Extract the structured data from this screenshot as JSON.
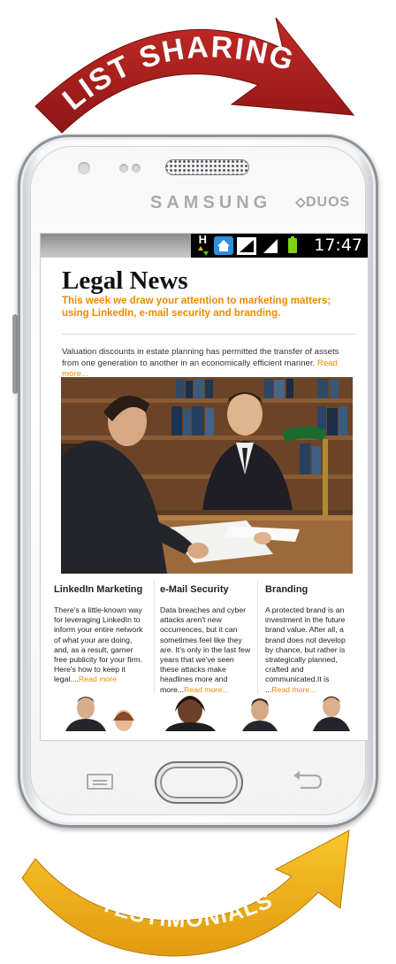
{
  "banner_top": "LIST SHARING",
  "banner_bottom": "TESTIMONIALS",
  "phone": {
    "brand": "SAMSUNG",
    "model": "DUOS",
    "status_time": "17:47",
    "status_net": "H"
  },
  "newsletter": {
    "title": "Legal News",
    "subtitle": "This week we draw your attention to marketing matters; using LinkedIn, e-mail security and branding.",
    "intro": "Valuation discounts in estate planning has permitted the transfer of assets from one generation to another in an economically efficient manner.",
    "intro_more": "Read more...",
    "columns": [
      {
        "heading": "LinkedIn Marketing",
        "body": "There's a little-known way for leveraging LinkedIn to inform your entire network of what your are doing, and, as a result, garner free publicity for your firm. Here's how to keep it legal....",
        "more": "Read more"
      },
      {
        "heading": "e-Mail Security",
        "body": "Data breaches and cyber attacks aren't new occurrences, but it can sometimes feel like they are. It's only in the last few years that we've seen these attacks make headlines more and more...",
        "more": "Read more..."
      },
      {
        "heading": "Branding",
        "body": "A protected brand is an investment in the future brand value. After all, a brand does not develop by chance, but rather is strategically planned, crafted and communicated.It is ...",
        "more": "Read more..."
      }
    ]
  },
  "colors": {
    "accent_orange": "#f08a00",
    "banner_red": "#a51d1d",
    "banner_yellow": "#f2b51b",
    "battery_green": "#7fd316"
  }
}
